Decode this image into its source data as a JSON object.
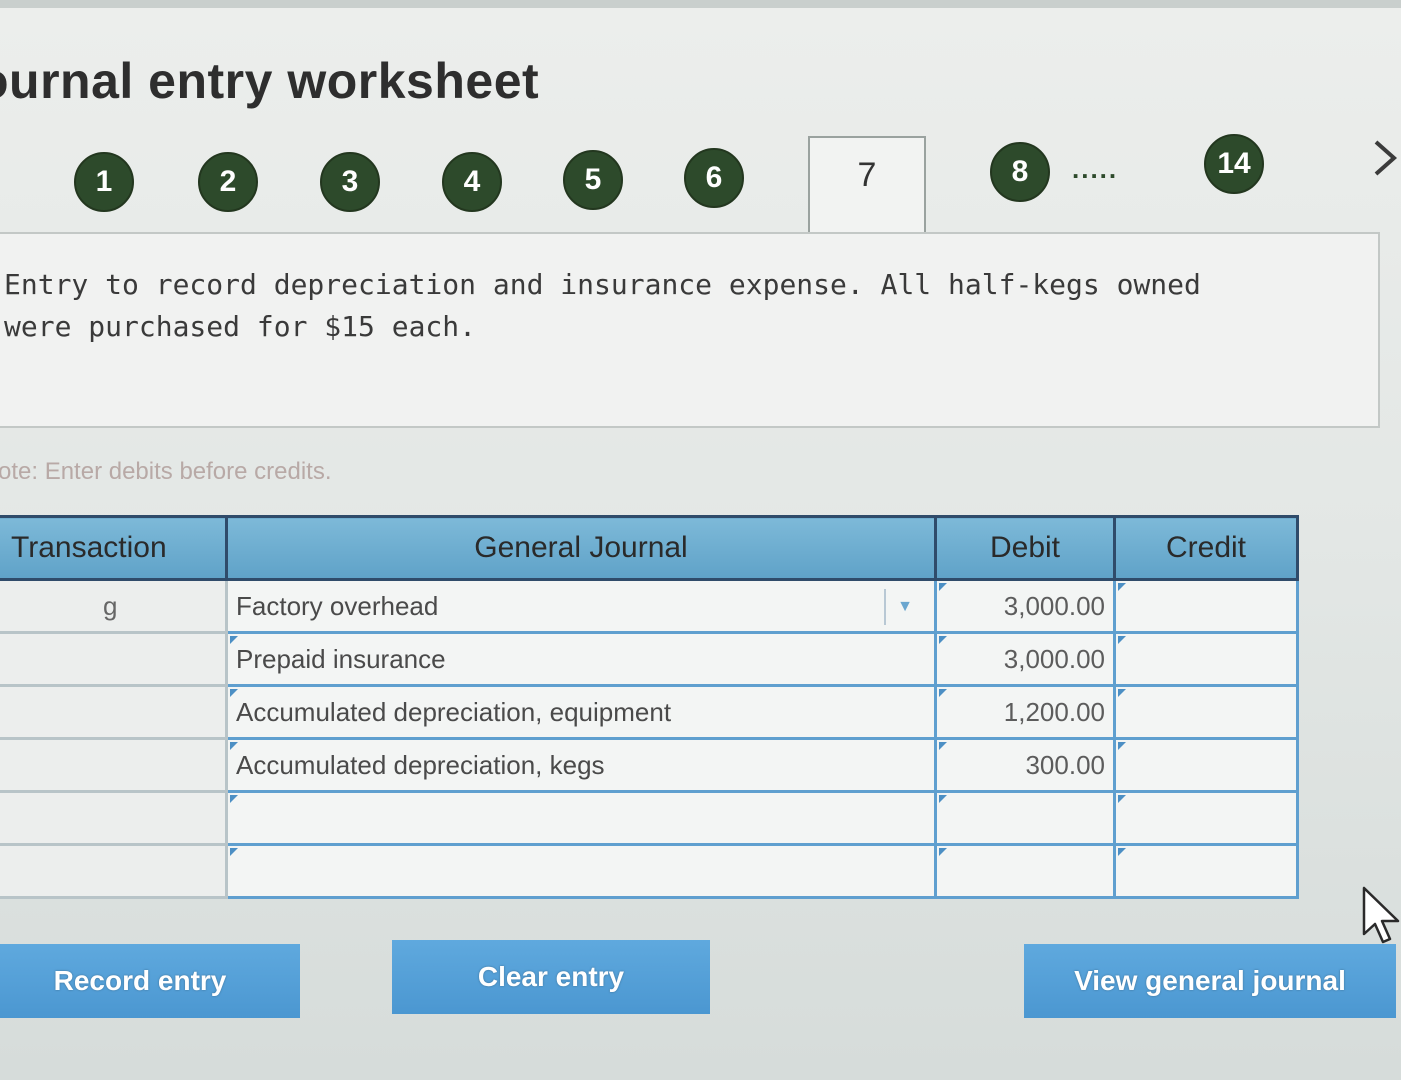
{
  "page": {
    "title": "ournal entry worksheet"
  },
  "stepper": {
    "steps": [
      "1",
      "2",
      "3",
      "4",
      "5",
      "6",
      "7",
      "8",
      "14"
    ],
    "active_step": "7",
    "ellipsis": ".....",
    "next_icon": "chevron-right-icon",
    "step_color": "#2d4a2b"
  },
  "description": {
    "text": "Entry to record depreciation and insurance expense. All half-kegs owned were purchased for $15 each."
  },
  "note": "ote: Enter debits before credits.",
  "journal": {
    "headers": {
      "transaction": "Transaction",
      "general_journal": "General Journal",
      "debit": "Debit",
      "credit": "Credit"
    },
    "rows": [
      {
        "transaction": "g",
        "account": "Factory overhead",
        "debit": "3,000.00",
        "credit": ""
      },
      {
        "transaction": "",
        "account": "Prepaid insurance",
        "debit": "3,000.00",
        "credit": ""
      },
      {
        "transaction": "",
        "account": "Accumulated depreciation, equipment",
        "debit": "1,200.00",
        "credit": ""
      },
      {
        "transaction": "",
        "account": "Accumulated depreciation, kegs",
        "debit": "300.00",
        "credit": ""
      },
      {
        "transaction": "",
        "account": "",
        "debit": "",
        "credit": ""
      },
      {
        "transaction": "",
        "account": "",
        "debit": "",
        "credit": ""
      }
    ],
    "header_color": "#6aadd2"
  },
  "buttons": {
    "record": "Record entry",
    "clear": "Clear entry",
    "view": "View general journal",
    "color": "#4f9bd4"
  }
}
